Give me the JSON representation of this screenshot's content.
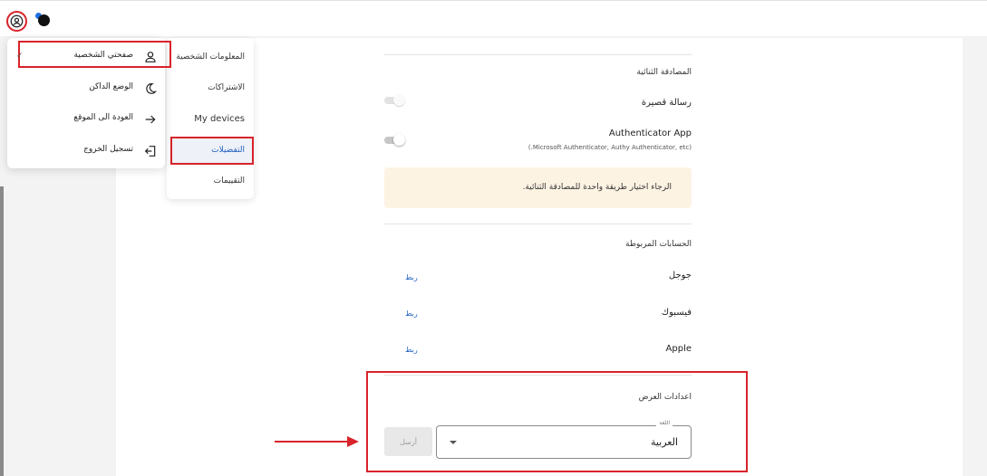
{
  "header": {
    "account_icon": "account-circle-icon",
    "brand_icon": "brand-logo-icon"
  },
  "user_menu": {
    "items": [
      {
        "label": "صفحتي الشخصية",
        "icon": "person-icon",
        "selected": true
      },
      {
        "label": "الوضع الداكن",
        "icon": "moon-icon"
      },
      {
        "label": "العودة الى الموقع",
        "icon": "arrow-right-icon"
      },
      {
        "label": "تسجيل الخروج",
        "icon": "logout-icon"
      }
    ],
    "check_mark": "✓"
  },
  "side_nav": {
    "items": [
      {
        "label": "المعلومات الشخصية"
      },
      {
        "label": "الاشتراكات"
      },
      {
        "label": "My devices"
      },
      {
        "label": "التفضيلات",
        "active": true
      },
      {
        "label": "التقييمات"
      }
    ]
  },
  "two_factor": {
    "title": "المصادقة الثنائية",
    "sms_label": "رسالة قصيرة",
    "authenticator_label": "Authenticator App",
    "authenticator_hint": "(.Microsoft Authenticator, Authy Authenticator, etc)",
    "notice": "الرجاء اختيار طريقة واحدة للمصادقة الثنائية."
  },
  "linked_accounts": {
    "title": "الحسابات المربوطة",
    "items": [
      {
        "name": "جوجل",
        "action": "ربط"
      },
      {
        "name": "فيسبوك",
        "action": "ربط"
      },
      {
        "name": "Apple",
        "action": "ربط"
      }
    ]
  },
  "display_settings": {
    "title": "اعدادات العرض",
    "language_label": "اللغة",
    "language_value": "العربية",
    "send_label": "أرسل"
  },
  "colors": {
    "highlight": "#d8232a",
    "accent": "#1f5fbf",
    "notice_bg": "#fdf3e3"
  }
}
